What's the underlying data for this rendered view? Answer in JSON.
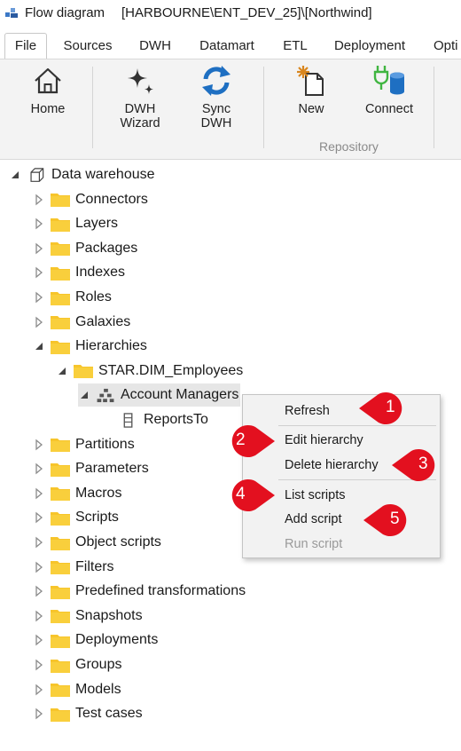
{
  "titlebar": {
    "app": "Flow diagram",
    "context": "[HARBOURNE\\ENT_DEV_25]\\[Northwind]"
  },
  "tabs": [
    "File",
    "Sources",
    "DWH",
    "Datamart",
    "ETL",
    "Deployment",
    "Opti"
  ],
  "ribbon": {
    "home": "Home",
    "dwh_wizard": [
      "DWH",
      "Wizard"
    ],
    "sync_dwh": [
      "Sync",
      "DWH"
    ],
    "new": "New",
    "connect": "Connect",
    "group_repository": "Repository"
  },
  "tree": {
    "root": "Data warehouse",
    "folders_top": [
      "Connectors",
      "Layers",
      "Packages",
      "Indexes",
      "Roles",
      "Galaxies"
    ],
    "hierarchies": "Hierarchies",
    "dim": "STAR.DIM_Employees",
    "hierarchy": "Account Managers",
    "level": "ReportsTo",
    "folders_bottom": [
      "Partitions",
      "Parameters",
      "Macros",
      "Scripts",
      "Object scripts",
      "Filters",
      "Predefined transformations",
      "Snapshots",
      "Deployments",
      "Groups",
      "Models",
      "Test cases"
    ]
  },
  "menu": {
    "refresh": "Refresh",
    "edit_hierarchy": "Edit hierarchy",
    "delete_hierarchy": "Delete hierarchy",
    "list_scripts": "List scripts",
    "add_script": "Add script",
    "run_script": "Run script"
  },
  "callouts": [
    "1",
    "2",
    "3",
    "4",
    "5"
  ],
  "colors": {
    "callout": "#e3101f",
    "folder": "#f7c52b",
    "accent_blue": "#1e6fc2",
    "connect_green": "#3fb540"
  }
}
